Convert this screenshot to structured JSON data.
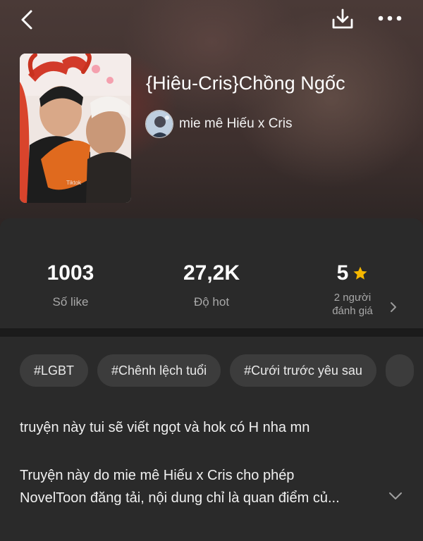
{
  "header": {
    "back_icon": "chevron-left-icon",
    "download_icon": "download-icon",
    "more_icon": "more-horizontal-icon"
  },
  "book": {
    "title": "{Hiêu-Cris}Chồng Ngốc",
    "author": "mie mê Hiếu x Cris",
    "cover_watermark": "Tiktok"
  },
  "stats": {
    "likes": {
      "value": "1003",
      "label": "Số like"
    },
    "hot": {
      "value": "27,2K",
      "label": "Độ hot"
    },
    "rating": {
      "value": "5",
      "label_line1": "2 người",
      "label_line2": "đánh giá",
      "star_color": "#f5b700"
    }
  },
  "tags": [
    "#LGBT",
    "#Chênh lệch tuổi",
    "#Cưới trước yêu sau"
  ],
  "description": {
    "line1": "truyện này tui sẽ viết ngọt và hok có H nha mn",
    "line2": "Truyện này do mie mê Hiếu x Cris cho phép",
    "line3": "NovelToon đăng tải, nội dung chỉ là quan điểm củ..."
  },
  "colors": {
    "background": "#202020",
    "panel": "#2a2a2a",
    "tag_bg": "#3c3c3c",
    "muted_text": "#a8a8a8",
    "star": "#f5b700"
  }
}
